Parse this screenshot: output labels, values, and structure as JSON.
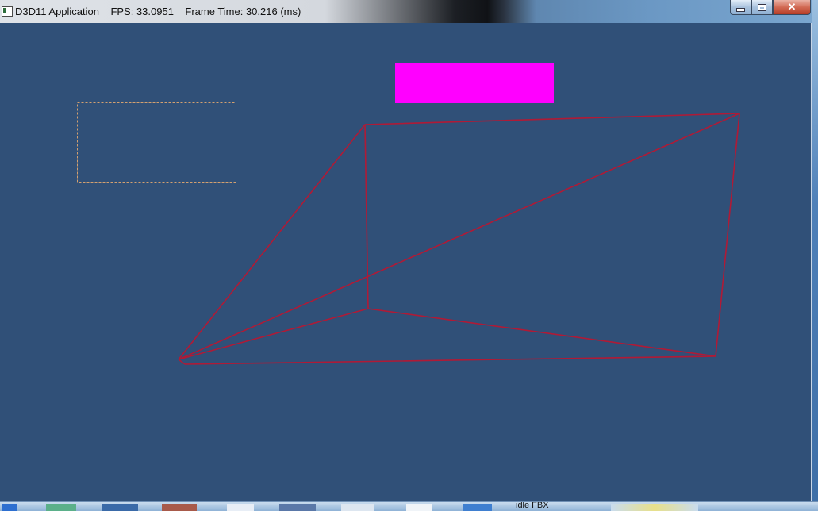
{
  "window": {
    "title": "D3D11 Application    FPS: 33.0951    Frame Time: 30.216 (ms)"
  },
  "taskbar": {
    "item_label": "idle FBX"
  },
  "colors": {
    "viewport_bg": "#305078",
    "wireframe": "#b01a36",
    "overlay_quad": "#ff00ff",
    "dashed_rect": "#d2a070"
  },
  "icons": {
    "app": "app-window-icon",
    "minimize": "minimize-icon",
    "maximize": "maximize-icon",
    "close": "close-icon"
  }
}
